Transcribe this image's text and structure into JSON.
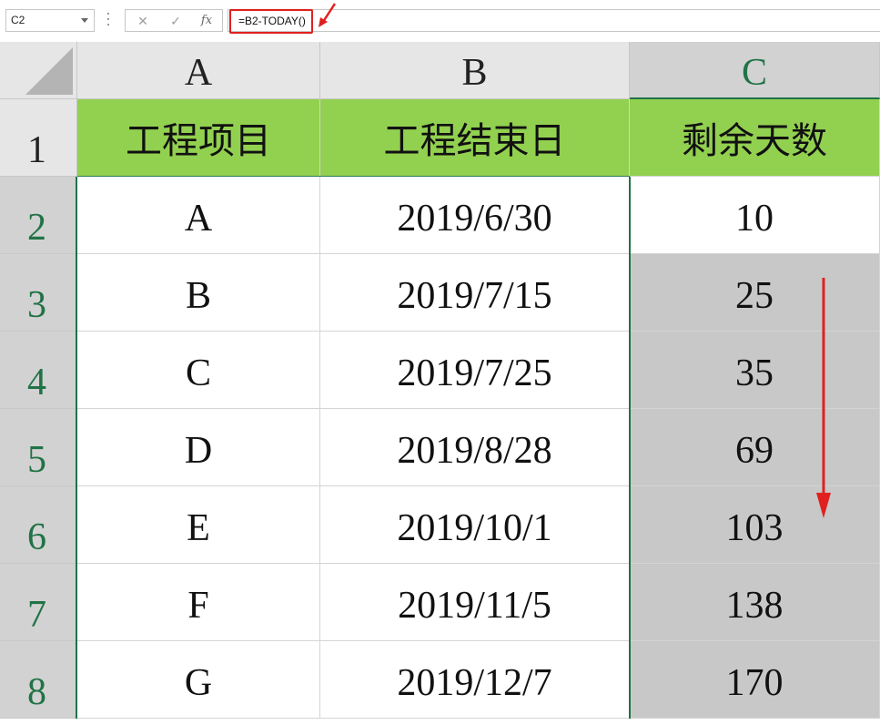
{
  "formula_bar": {
    "name_box": "C2",
    "cancel_icon": "✕",
    "enter_icon": "✓",
    "fx_label": "fx",
    "formula": "=B2-TODAY()"
  },
  "columns": [
    "A",
    "B",
    "C"
  ],
  "rows": [
    "1",
    "2",
    "3",
    "4",
    "5",
    "6",
    "7",
    "8"
  ],
  "header_row": [
    "工程项目",
    "工程结束日",
    "剩余天数"
  ],
  "data_rows": [
    {
      "project": "A",
      "end_date": "2019/6/30",
      "days_left": "10"
    },
    {
      "project": "B",
      "end_date": "2019/7/15",
      "days_left": "25"
    },
    {
      "project": "C",
      "end_date": "2019/7/25",
      "days_left": "35"
    },
    {
      "project": "D",
      "end_date": "2019/8/28",
      "days_left": "69"
    },
    {
      "project": "E",
      "end_date": "2019/10/1",
      "days_left": "103"
    },
    {
      "project": "F",
      "end_date": "2019/11/5",
      "days_left": "138"
    },
    {
      "project": "G",
      "end_date": "2019/12/7",
      "days_left": "170"
    }
  ],
  "colors": {
    "header_fill": "#92d050",
    "selection_fill": "#c8c8c8",
    "selection_border": "#217346",
    "annotation_red": "#e02020"
  }
}
